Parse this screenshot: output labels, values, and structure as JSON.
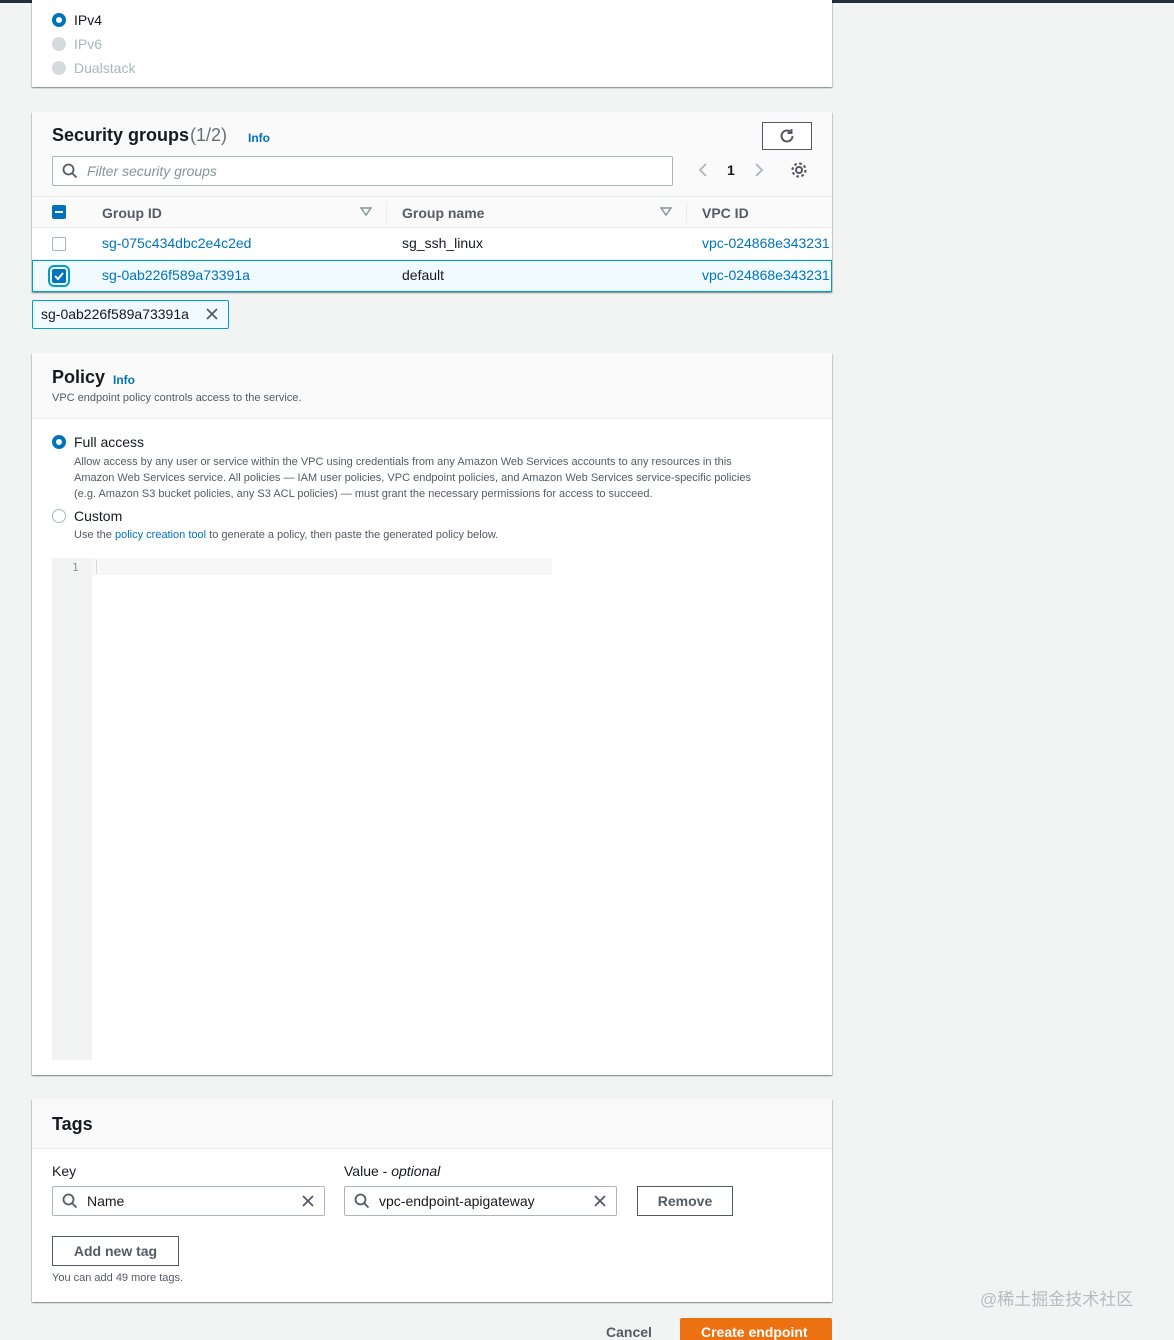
{
  "ip_options": [
    {
      "label": "IPv4",
      "state": "selected"
    },
    {
      "label": "IPv6",
      "state": "disabled"
    },
    {
      "label": "Dualstack",
      "state": "disabled"
    }
  ],
  "security_groups": {
    "title": "Security groups",
    "count": "(1/2)",
    "info": "Info",
    "filter_placeholder": "Filter security groups",
    "page_number": "1",
    "columns": [
      "Group ID",
      "Group name",
      "VPC ID"
    ],
    "rows": [
      {
        "group_id": "sg-075c434dbc2e4c2ed",
        "group_name": "sg_ssh_linux",
        "vpc_id": "vpc-024868e343231",
        "selected": false
      },
      {
        "group_id": "sg-0ab226f589a73391a",
        "group_name": "default",
        "vpc_id": "vpc-024868e343231",
        "selected": true
      }
    ],
    "selected_token": "sg-0ab226f589a73391a"
  },
  "policy": {
    "title": "Policy",
    "info": "Info",
    "description": "VPC endpoint policy controls access to the service.",
    "full_access_label": "Full access",
    "full_access_desc_1": "Allow access by any user or service within the VPC using credentials from any Amazon Web Services accounts to any resources in this",
    "full_access_desc_2": "Amazon Web Services service. All policies — IAM user policies, VPC endpoint policies, and Amazon Web Services service-specific policies",
    "full_access_desc_3": "(e.g. Amazon S3 bucket policies, any S3 ACL policies) — must grant the necessary permissions for access to succeed.",
    "custom_label": "Custom",
    "custom_desc_prefix": "Use the",
    "custom_desc_link": "policy creation tool",
    "custom_desc_suffix": "to generate a policy, then paste the generated policy below.",
    "editor_line": "1"
  },
  "tags": {
    "title": "Tags",
    "key_label": "Key",
    "value_label": "Value - ",
    "value_optional": "optional",
    "key_value": "Name",
    "value_value": "vpc-endpoint-apigateway",
    "remove_label": "Remove",
    "add_label": "Add new tag",
    "hint": "You can add 49 more tags."
  },
  "footer": {
    "cancel_label": "Cancel",
    "create_label": "Create endpoint"
  },
  "watermark": "@稀土掘金技术社区",
  "colors": {
    "accent": "#0073bb",
    "primary_button": "#ec7211",
    "selected_row_bg": "#f1faff"
  }
}
